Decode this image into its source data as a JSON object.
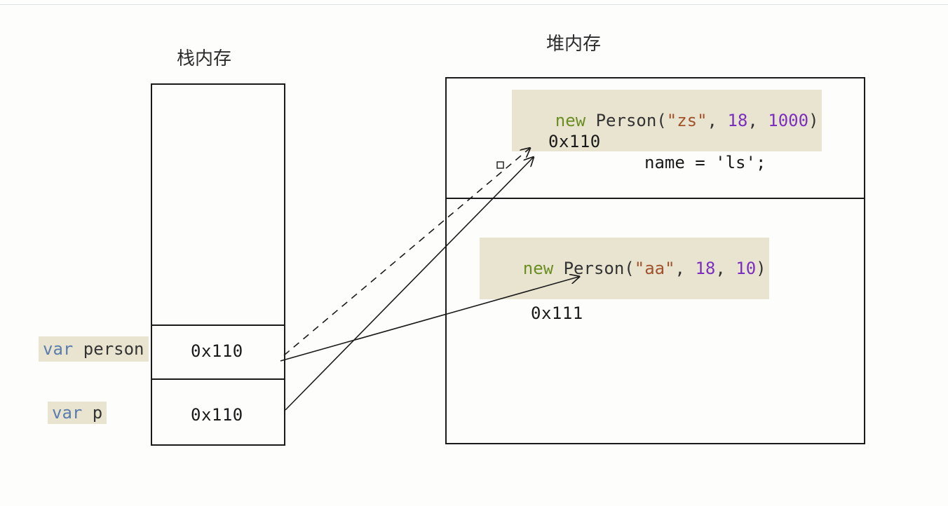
{
  "titles": {
    "stack": "栈内存",
    "heap": "堆内存"
  },
  "stack": {
    "cell1_addr": "0x110",
    "cell2_addr": "0x110"
  },
  "stack_vars": {
    "var_person": "var person",
    "var_p": "var p"
  },
  "heap": {
    "obj1": {
      "kw_new": "new",
      "type": " Person(",
      "arg1": "\"zs\"",
      "comma1": ", ",
      "arg2": "18",
      "comma2": ", ",
      "arg3": "1000",
      "close": ")"
    },
    "obj1_addr": "0x110",
    "obj1_assign": "name = 'ls';",
    "obj2": {
      "kw_new": "new",
      "type": " Person(",
      "arg1": "\"aa\"",
      "comma1": ", ",
      "arg2": "18",
      "comma2": ", ",
      "arg3": "10",
      "close": ")"
    },
    "obj2_addr": "0x111"
  }
}
